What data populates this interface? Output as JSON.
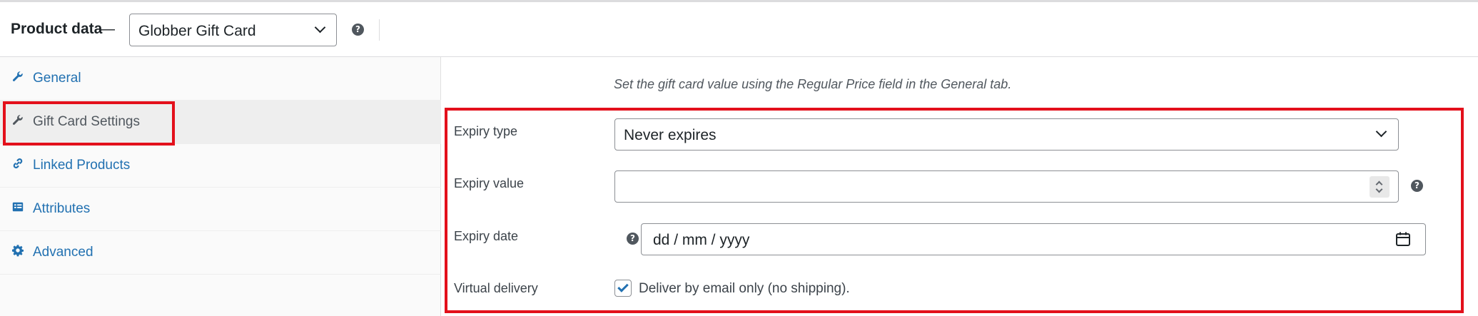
{
  "header": {
    "title": "Product data",
    "dash": "—",
    "product_type": "Globber Gift Card",
    "help_glyph": "?"
  },
  "sidebar": {
    "items": [
      {
        "label": "General",
        "icon": "wrench-icon",
        "active": false
      },
      {
        "label": "Gift Card Settings",
        "icon": "wrench-icon",
        "active": true
      },
      {
        "label": "Linked Products",
        "icon": "link-icon",
        "active": false
      },
      {
        "label": "Attributes",
        "icon": "list-icon",
        "active": false
      },
      {
        "label": "Advanced",
        "icon": "gear-icon",
        "active": false
      }
    ]
  },
  "panel": {
    "note": "Set the gift card value using the Regular Price field in the General tab.",
    "expiry_type": {
      "label": "Expiry type",
      "value": "Never expires"
    },
    "expiry_value": {
      "label": "Expiry value",
      "value": ""
    },
    "expiry_date": {
      "label": "Expiry date",
      "placeholder": "dd / mm / yyyy"
    },
    "virtual_delivery": {
      "label": "Virtual delivery",
      "checkbox_label": "Deliver by email only (no shipping).",
      "checked": true
    }
  },
  "colors": {
    "link": "#2271b1",
    "highlight": "#e3101b",
    "text": "#1d2327"
  }
}
